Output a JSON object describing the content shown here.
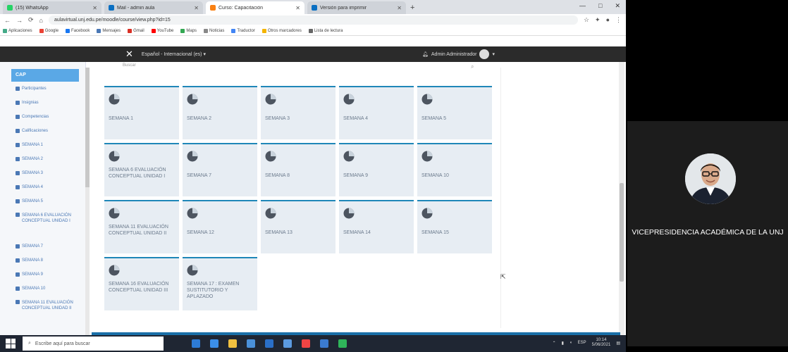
{
  "browser": {
    "tabs": [
      {
        "label": "(15) WhatsApp",
        "color": "#25d366"
      },
      {
        "label": "Mail - admin aula",
        "color": "#0a6fc2"
      },
      {
        "label": "Curso: Capacitación",
        "color": "#f98012",
        "active": true
      },
      {
        "label": "Versión para imprimir",
        "color": "#0a6fc2"
      }
    ],
    "newtab": "+",
    "address": "aulavirtual.unj.edu.pe/moodle/course/view.php?id=15",
    "window_controls": [
      "—",
      "□",
      "✕"
    ],
    "bookmarks": [
      "Aplicaciones",
      "Google",
      "Facebook",
      "Mensajes",
      "Gmail",
      "YouTube",
      "Maps",
      "Noticias",
      "Traductor",
      "Otros marcadores",
      "Lista de lectura"
    ]
  },
  "moodle": {
    "close_symbol": "✕",
    "language": "Español - Internacional (es) ▾",
    "user": "Admin Administrador",
    "search_hint": "Buscar",
    "sidebar": {
      "head": "CAP",
      "items": [
        "Participantes",
        "Insignias",
        "Competencias",
        "Calificaciones",
        "SEMANA 1",
        "SEMANA 2",
        "SEMANA 3",
        "SEMANA 4",
        "SEMANA 5",
        "SEMANA 6 EVALUACIÓN CONCEPTUAL UNIDAD I",
        "SEMANA 7",
        "SEMANA 8",
        "SEMANA 9",
        "SEMANA 10",
        "SEMANA 11 EVALUACIÓN CONCEPTUAL UNIDAD II"
      ]
    },
    "tiles": [
      "SEMANA 1",
      "SEMANA 2",
      "SEMANA 3",
      "SEMANA 4",
      "SEMANA 5",
      "SEMANA 6 EVALUACIÓN CONCEPTUAL UNIDAD I",
      "SEMANA 7",
      "SEMANA 8",
      "SEMANA 9",
      "SEMANA 10",
      "SEMANA 11 EVALUACIÓN CONCEPTUAL UNIDAD II",
      "SEMANA 12",
      "SEMANA 13",
      "SEMANA 14",
      "SEMANA 15",
      "SEMANA 16 EVALUACIÓN CONCEPTUAL UNIDAD III",
      "SEMANA 17 : EXAMEN SUSTITUTORIO Y APLAZADO"
    ],
    "tile_accent": "#1f87b8"
  },
  "taskbar": {
    "search_placeholder": "Escribe aquí para buscar",
    "tray_lang": "ESP",
    "time": "10:14",
    "date": "5/06/2021"
  },
  "video": {
    "speaker_name": "VICEPRESIDENCIA ACADÉMICA DE LA UNJ"
  }
}
